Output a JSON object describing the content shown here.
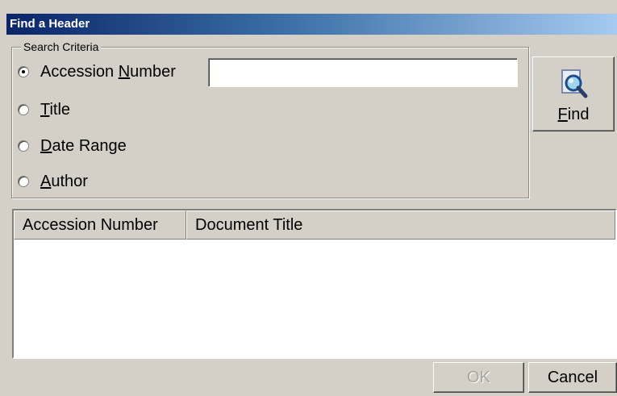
{
  "window": {
    "title": "Find a Header"
  },
  "search": {
    "group_label": "Search Criteria",
    "options": [
      {
        "key": "accession",
        "prefix": "Accession ",
        "mnemonic": "N",
        "suffix": "umber",
        "checked": true
      },
      {
        "key": "title",
        "prefix": "",
        "mnemonic": "T",
        "suffix": "itle",
        "checked": false
      },
      {
        "key": "date",
        "prefix": "",
        "mnemonic": "D",
        "suffix": "ate Range",
        "checked": false
      },
      {
        "key": "author",
        "prefix": "",
        "mnemonic": "A",
        "suffix": "uthor",
        "checked": false
      }
    ],
    "input_value": ""
  },
  "find_button": {
    "mnemonic": "F",
    "rest": "ind",
    "icon": "magnifier-icon"
  },
  "results": {
    "columns": [
      "Accession Number",
      "Document Title"
    ],
    "rows": []
  },
  "footer": {
    "ok_label": "OK",
    "ok_enabled": false,
    "cancel_label": "Cancel"
  }
}
